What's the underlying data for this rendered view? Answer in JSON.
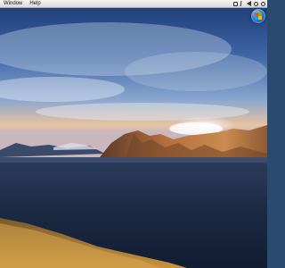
{
  "menubar": {
    "items": [
      {
        "label": "Window"
      },
      {
        "label": "Help"
      }
    ]
  },
  "colors": {
    "sky_top": "#1f3f78",
    "sky_mid": "#5a7fb8",
    "horizon_glow": "#f2c59a",
    "lake": "#1c2a44",
    "mountain": "#a66a3c",
    "grass": "#b8843c"
  },
  "icons": [
    "monitor-icon",
    "bluetooth-icon",
    "volume-icon",
    "clock-icon",
    "spotlight-search-icon",
    "windows-start-orb-icon"
  ]
}
